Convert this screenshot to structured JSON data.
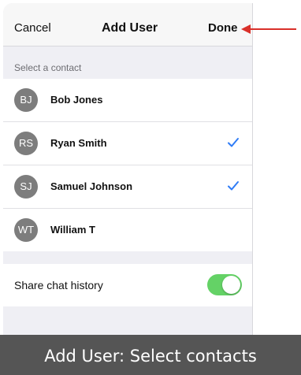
{
  "navbar": {
    "cancel_label": "Cancel",
    "title": "Add User",
    "done_label": "Done"
  },
  "contacts": {
    "header": "Select a contact",
    "items": [
      {
        "initials": "BJ",
        "name": "Bob Jones",
        "selected": false
      },
      {
        "initials": "RS",
        "name": "Ryan Smith",
        "selected": true
      },
      {
        "initials": "SJ",
        "name": "Samuel Johnson",
        "selected": true
      },
      {
        "initials": "WT",
        "name": "William T",
        "selected": false
      }
    ]
  },
  "share_history": {
    "label": "Share chat history",
    "enabled": true
  },
  "caption": "Add User: Select contacts",
  "colors": {
    "accent_check": "#2f7cf6",
    "toggle_on": "#64d266",
    "arrow": "#d9302a",
    "avatar_bg": "#7d7d7d",
    "caption_bg": "#555555"
  },
  "icons": {
    "checkmark": "checkmark-icon",
    "pointer": "arrow-left-icon"
  }
}
